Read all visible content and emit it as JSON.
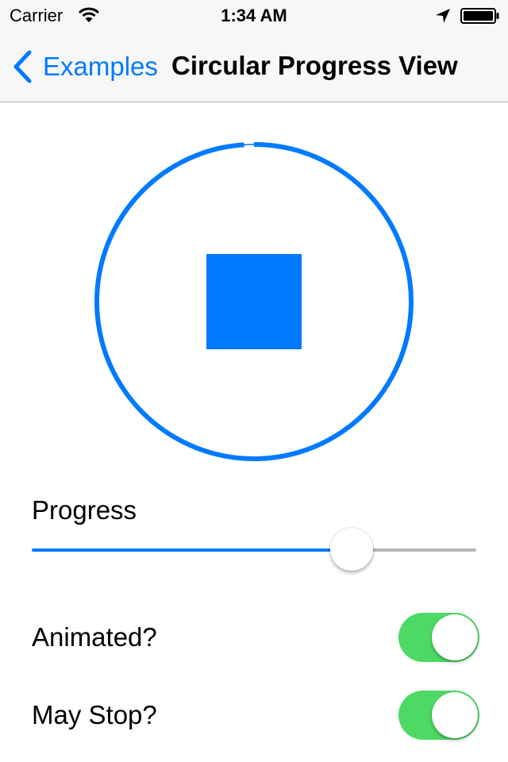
{
  "status_bar": {
    "carrier": "Carrier",
    "time": "1:34 AM",
    "icons": [
      "wifi-icon",
      "location-arrow-icon",
      "battery-icon"
    ]
  },
  "nav": {
    "back_label": "Examples",
    "title": "Circular Progress View"
  },
  "progress_view": {
    "progress": 0.99,
    "state": "stop-icon"
  },
  "controls": {
    "progress_label": "Progress",
    "slider_value": 0.72,
    "animated_label": "Animated?",
    "animated_on": true,
    "may_stop_label": "May Stop?",
    "may_stop_on": true
  },
  "colors": {
    "tint": "#007aff",
    "switch_on": "#4cd964",
    "track_off": "#b7b7b7"
  }
}
